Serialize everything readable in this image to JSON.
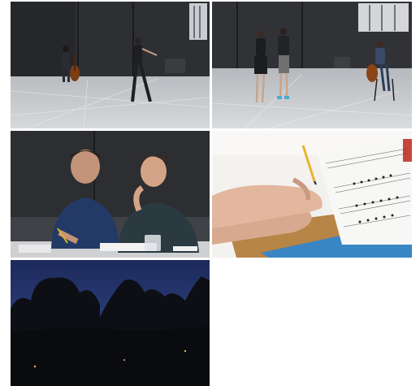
{
  "gallery": {
    "tiles": [
      {
        "icon": "photo-cellist-and-dancer-rehearsal-hall"
      },
      {
        "icon": "photo-two-dancers-and-cellist-rehearsal-hall"
      },
      {
        "icon": "photo-two-people-writing-at-table"
      },
      {
        "icon": "photo-hand-annotating-sheet-music"
      },
      {
        "icon": "photo-tree-silhouettes-at-dusk"
      }
    ]
  }
}
